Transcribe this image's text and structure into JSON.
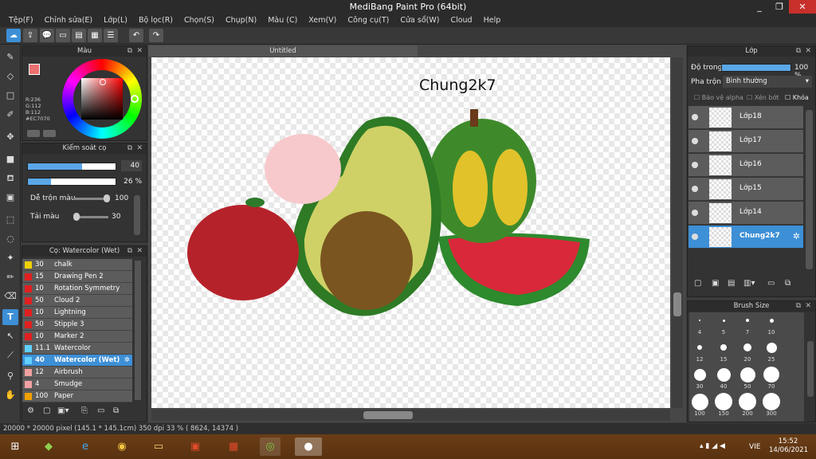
{
  "app": {
    "title": "MediBang Paint Pro (64bit)",
    "minimize": "_",
    "maximize": "❐",
    "close": "✕"
  },
  "menu": [
    "Tệp(F)",
    "Chỉnh sửa(E)",
    "Lớp(L)",
    "Bộ lọc(R)",
    "Chọn(S)",
    "Chụp(N)",
    "Màu (C)",
    "Xem(V)",
    "Công cụ(T)",
    "Cửa sổ(W)",
    "Cloud",
    "Help"
  ],
  "document": {
    "tab_title": "Untitled",
    "canvas_text": "Chung2k7"
  },
  "color_panel": {
    "title": "Màu",
    "r": "R:236",
    "g": "G:112",
    "b": "B:112",
    "hex": "#EC7070",
    "primary_color": "#EC7070"
  },
  "brush_control": {
    "title": "Kiểm soát cọ",
    "size_value": "40",
    "size_fraction": 0.62,
    "opacity_value": "26 %",
    "opacity_fraction": 0.26,
    "blend_label": "Dễ trộn màu",
    "blend_value": "100",
    "taimau_label": "Tải màu",
    "taimau_value": "30"
  },
  "brush_list": {
    "title": "Cọ: Watercolor (Wet)",
    "items": [
      {
        "num": "30",
        "name": "chalk",
        "color": "#f0d000"
      },
      {
        "num": "15",
        "name": "Drawing Pen 2",
        "color": "#e02020"
      },
      {
        "num": "10",
        "name": "Rotation Symmetry Pen",
        "color": "#e02020"
      },
      {
        "num": "50",
        "name": "Cloud 2",
        "color": "#e02020"
      },
      {
        "num": "10",
        "name": "Lightning",
        "color": "#e02020"
      },
      {
        "num": "50",
        "name": "Stipple 3",
        "color": "#e02020"
      },
      {
        "num": "10",
        "name": "Marker 2",
        "color": "#e02020"
      },
      {
        "num": "11.1",
        "name": "Watercolor",
        "color": "#60d0ff"
      },
      {
        "num": "40",
        "name": "Watercolor (Wet)",
        "color": "#60d0ff"
      },
      {
        "num": "12",
        "name": "Airbrush",
        "color": "#f0a0a0"
      },
      {
        "num": "4",
        "name": "Smudge",
        "color": "#f0a0a0"
      },
      {
        "num": "100",
        "name": "Paper",
        "color": "#f0a000"
      }
    ]
  },
  "layer_panel": {
    "title": "Lớp",
    "opacity_label": "Độ trong",
    "opacity_value": "100 %",
    "blend_label": "Pha trộn",
    "blend_value": "Bình thường",
    "protect_alpha": "Bảo vệ alpha",
    "clipping": "Xén bớt",
    "lock": "Khóa",
    "layers": [
      "Lớp18",
      "Lớp17",
      "Lớp16",
      "Lớp15",
      "Lớp14",
      "Chung2k7"
    ]
  },
  "brush_size": {
    "title": "Brush Size",
    "sizes": [
      "4",
      "5",
      "7",
      "10",
      "12",
      "15",
      "20",
      "25",
      "30",
      "40",
      "50",
      "70",
      "100",
      "150",
      "200",
      "300"
    ]
  },
  "status": {
    "text": "20000 * 20000 pixel   (145.1 * 145.1cm)   350 dpi   33 %   ( 8624, 14374 )"
  },
  "taskbar": {
    "lang": "VIE",
    "time": "15:52",
    "date": "14/06/2021"
  }
}
